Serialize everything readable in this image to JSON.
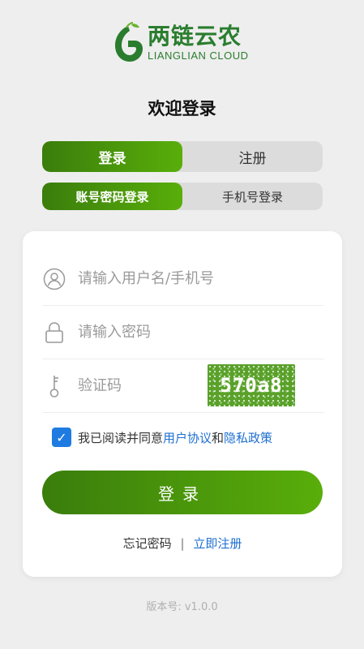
{
  "logo": {
    "name_cn": "两链云农",
    "name_en": "LIANGLIAN CLOUD"
  },
  "welcome": "欢迎登录",
  "auth_tabs": {
    "login": "登录",
    "register": "注册",
    "active": "login"
  },
  "login_modes": {
    "account": "账号密码登录",
    "phone": "手机号登录",
    "active": "account"
  },
  "form": {
    "username_placeholder": "请输入用户名/手机号",
    "password_placeholder": "请输入密码",
    "captcha_placeholder": "验证码",
    "captcha_code": "570a8"
  },
  "agreement": {
    "checked": true,
    "prefix": "我已阅读并同意",
    "user_agreement": "用户协议",
    "and": "和",
    "privacy_policy": "隐私政策"
  },
  "login_button": "登录",
  "links": {
    "forgot": "忘记密码",
    "separator": "|",
    "register_now": "立即注册"
  },
  "version": "版本号: v1.0.0",
  "colors": {
    "brand_green": "#2a7d2e",
    "gradient_start": "#3a7d0c",
    "gradient_end": "#59ae0a",
    "link_blue": "#1e6fd0"
  },
  "icons": [
    "user-icon",
    "lock-icon",
    "key-icon",
    "check-icon"
  ]
}
